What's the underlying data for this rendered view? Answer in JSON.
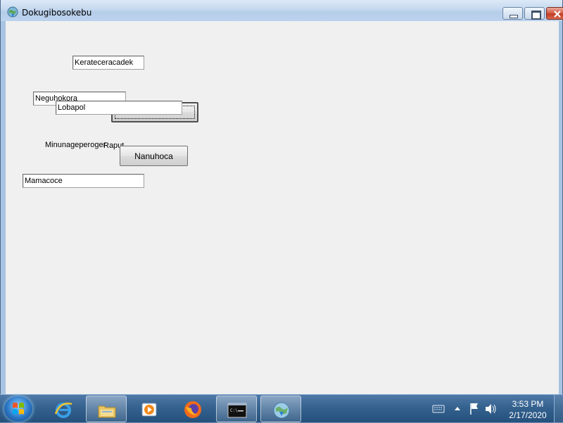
{
  "window": {
    "title": "Dokugibosokebu"
  },
  "form": {
    "textbox_1": "Kerateceracadek",
    "textbox_2": "Neguhokora",
    "textbox_3": "Lobapol",
    "button_hidden_label": "",
    "label_1": "Minunageperoger",
    "label_2": "Raput",
    "button_1": "Nanuhoca",
    "textbox_4": "Mamacoce"
  },
  "taskbar": {
    "items": [
      "internet-explorer",
      "file-explorer",
      "media-player",
      "firefox",
      "command-prompt",
      "network-installer"
    ],
    "clock_time": "3:53 PM",
    "clock_date": "2/17/2020"
  },
  "colors": {
    "window_bg": "#f0f0f0",
    "taskbar_blue": "#35628f"
  }
}
